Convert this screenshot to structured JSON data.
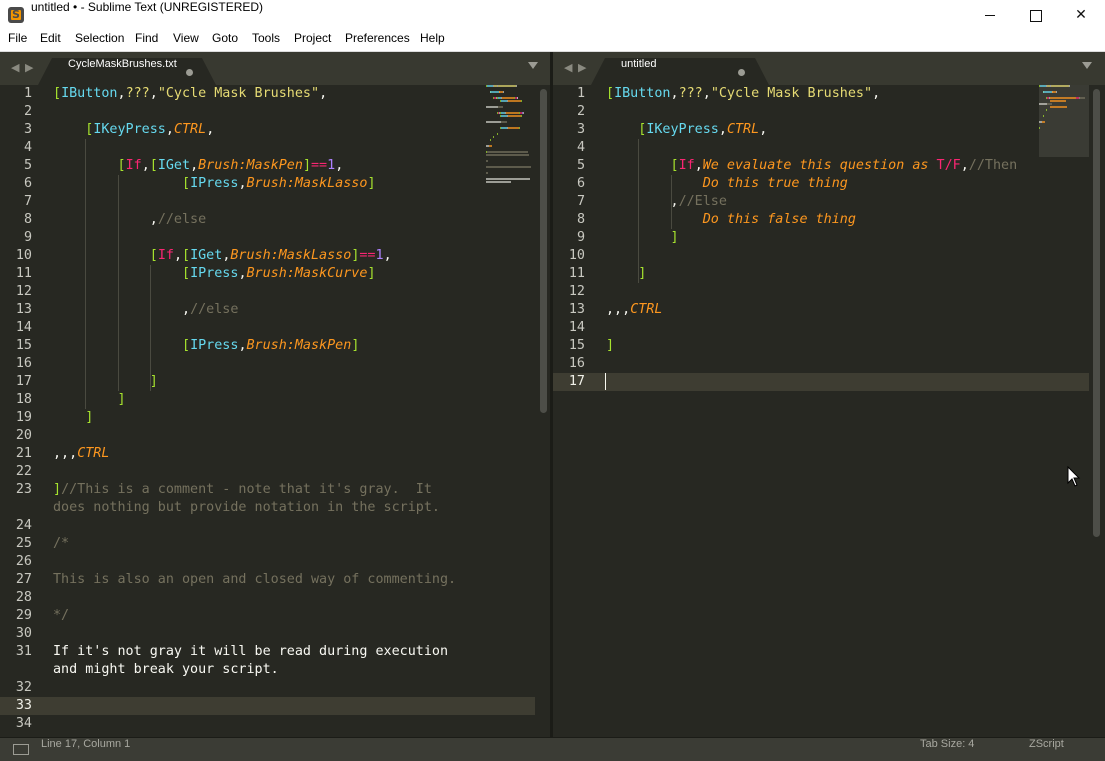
{
  "window": {
    "title": "untitled • - Sublime Text (UNREGISTERED)",
    "app_icon_glyph": "S",
    "minimize_glyph": "",
    "maximize_glyph": "",
    "close_glyph": "✕"
  },
  "menu": [
    "File",
    "Edit",
    "Selection",
    "Find",
    "View",
    "Goto",
    "Tools",
    "Project",
    "Preferences",
    "Help"
  ],
  "left_pane": {
    "tab_label": "CycleMaskBrushes.txt",
    "nav_back": "◀",
    "nav_forward": "▶",
    "lines": [
      {
        "n": "1",
        "tokens": [
          [
            "b",
            "["
          ],
          [
            "c",
            "IButton"
          ],
          [
            "w",
            ","
          ],
          [
            "y",
            "???"
          ],
          [
            "w",
            ","
          ],
          [
            "y",
            "\"Cycle Mask Brushes\""
          ],
          [
            "w",
            ","
          ]
        ]
      },
      {
        "n": "2",
        "tokens": []
      },
      {
        "n": "3",
        "tokens": [
          [
            "w",
            "    "
          ],
          [
            "b",
            "["
          ],
          [
            "c",
            "IKeyPress"
          ],
          [
            "w",
            ","
          ],
          [
            "o",
            "CTRL"
          ],
          [
            "w",
            ","
          ]
        ]
      },
      {
        "n": "4",
        "tokens": []
      },
      {
        "n": "5",
        "tokens": [
          [
            "w",
            "        "
          ],
          [
            "b",
            "["
          ],
          [
            "p",
            "If"
          ],
          [
            "w",
            ","
          ],
          [
            "b",
            "["
          ],
          [
            "c",
            "IGet"
          ],
          [
            "w",
            ","
          ],
          [
            "o",
            "Brush:MaskPen"
          ],
          [
            "b",
            "]"
          ],
          [
            "p",
            "=="
          ],
          [
            "n",
            "1"
          ],
          [
            "w",
            ","
          ]
        ]
      },
      {
        "n": "6",
        "tokens": [
          [
            "w",
            "                "
          ],
          [
            "b",
            "["
          ],
          [
            "c",
            "IPress"
          ],
          [
            "w",
            ","
          ],
          [
            "o",
            "Brush:MaskLasso"
          ],
          [
            "b",
            "]"
          ]
        ]
      },
      {
        "n": "7",
        "tokens": []
      },
      {
        "n": "8",
        "tokens": [
          [
            "w",
            "            ,"
          ],
          [
            "g",
            "//else"
          ]
        ]
      },
      {
        "n": "9",
        "tokens": []
      },
      {
        "n": "10",
        "tokens": [
          [
            "w",
            "            "
          ],
          [
            "b",
            "["
          ],
          [
            "p",
            "If"
          ],
          [
            "w",
            ","
          ],
          [
            "b",
            "["
          ],
          [
            "c",
            "IGet"
          ],
          [
            "w",
            ","
          ],
          [
            "o",
            "Brush:MaskLasso"
          ],
          [
            "b",
            "]"
          ],
          [
            "p",
            "=="
          ],
          [
            "n",
            "1"
          ],
          [
            "w",
            ","
          ]
        ]
      },
      {
        "n": "11",
        "tokens": [
          [
            "w",
            "                "
          ],
          [
            "b",
            "["
          ],
          [
            "c",
            "IPress"
          ],
          [
            "w",
            ","
          ],
          [
            "o",
            "Brush:MaskCurve"
          ],
          [
            "b",
            "]"
          ]
        ]
      },
      {
        "n": "12",
        "tokens": []
      },
      {
        "n": "13",
        "tokens": [
          [
            "w",
            "                ,"
          ],
          [
            "g",
            "//else"
          ]
        ]
      },
      {
        "n": "14",
        "tokens": []
      },
      {
        "n": "15",
        "tokens": [
          [
            "w",
            "                "
          ],
          [
            "b",
            "["
          ],
          [
            "c",
            "IPress"
          ],
          [
            "w",
            ","
          ],
          [
            "o",
            "Brush:MaskPen"
          ],
          [
            "b",
            "]"
          ]
        ]
      },
      {
        "n": "16",
        "tokens": []
      },
      {
        "n": "17",
        "tokens": [
          [
            "w",
            "            "
          ],
          [
            "b",
            "]"
          ]
        ]
      },
      {
        "n": "18",
        "tokens": [
          [
            "w",
            "        "
          ],
          [
            "b",
            "]"
          ]
        ]
      },
      {
        "n": "19",
        "tokens": [
          [
            "w",
            "    "
          ],
          [
            "b",
            "]"
          ]
        ]
      },
      {
        "n": "20",
        "tokens": []
      },
      {
        "n": "21",
        "tokens": [
          [
            "w",
            ",,,"
          ],
          [
            "o",
            "CTRL"
          ]
        ]
      },
      {
        "n": "22",
        "tokens": []
      },
      {
        "n": "23",
        "tokens": [
          [
            "b",
            "]"
          ],
          [
            "g",
            "//This is a comment - note that it's gray.  It"
          ]
        ]
      },
      {
        "n": "",
        "tokens": [
          [
            "g",
            "does nothing but provide notation in the script."
          ]
        ]
      },
      {
        "n": "24",
        "tokens": []
      },
      {
        "n": "25",
        "tokens": [
          [
            "g",
            "/*"
          ]
        ]
      },
      {
        "n": "26",
        "tokens": []
      },
      {
        "n": "27",
        "tokens": [
          [
            "g",
            "This is also an open and closed way of commenting."
          ]
        ]
      },
      {
        "n": "28",
        "tokens": []
      },
      {
        "n": "29",
        "tokens": [
          [
            "g",
            "*/"
          ]
        ]
      },
      {
        "n": "30",
        "tokens": []
      },
      {
        "n": "31",
        "tokens": [
          [
            "w",
            "If it's not gray it will be read during execution"
          ]
        ]
      },
      {
        "n": "",
        "tokens": [
          [
            "w",
            "and might break your script."
          ]
        ]
      },
      {
        "n": "32",
        "tokens": []
      },
      {
        "n": "33",
        "tokens": [],
        "current": true
      },
      {
        "n": "34",
        "tokens": []
      }
    ]
  },
  "right_pane": {
    "tab_label": "untitled",
    "nav_back": "◀",
    "nav_forward": "▶",
    "lines": [
      {
        "n": "1",
        "tokens": [
          [
            "b",
            "["
          ],
          [
            "c",
            "IButton"
          ],
          [
            "w",
            ","
          ],
          [
            "y",
            "???"
          ],
          [
            "w",
            ","
          ],
          [
            "y",
            "\"Cycle Mask Brushes\""
          ],
          [
            "w",
            ","
          ]
        ]
      },
      {
        "n": "2",
        "tokens": []
      },
      {
        "n": "3",
        "tokens": [
          [
            "w",
            "    "
          ],
          [
            "b",
            "["
          ],
          [
            "c",
            "IKeyPress"
          ],
          [
            "w",
            ","
          ],
          [
            "o",
            "CTRL"
          ],
          [
            "w",
            ","
          ]
        ]
      },
      {
        "n": "4",
        "tokens": []
      },
      {
        "n": "5",
        "tokens": [
          [
            "w",
            "        "
          ],
          [
            "b",
            "["
          ],
          [
            "p",
            "If"
          ],
          [
            "w",
            ","
          ],
          [
            "o",
            "We evaluate this question as "
          ],
          [
            "p",
            "T/F"
          ],
          [
            "w",
            ","
          ],
          [
            "g",
            "//Then"
          ]
        ]
      },
      {
        "n": "6",
        "tokens": [
          [
            "w",
            "            "
          ],
          [
            "o",
            "Do this true thing"
          ]
        ]
      },
      {
        "n": "7",
        "tokens": [
          [
            "w",
            "        ,"
          ],
          [
            "g",
            "//Else"
          ]
        ]
      },
      {
        "n": "8",
        "tokens": [
          [
            "w",
            "            "
          ],
          [
            "o",
            "Do this false thing"
          ]
        ]
      },
      {
        "n": "9",
        "tokens": [
          [
            "w",
            "        "
          ],
          [
            "b",
            "]"
          ]
        ]
      },
      {
        "n": "10",
        "tokens": []
      },
      {
        "n": "11",
        "tokens": [
          [
            "w",
            "    "
          ],
          [
            "b",
            "]"
          ]
        ]
      },
      {
        "n": "12",
        "tokens": []
      },
      {
        "n": "13",
        "tokens": [
          [
            "w",
            ",,,"
          ],
          [
            "o",
            "CTRL"
          ]
        ]
      },
      {
        "n": "14",
        "tokens": []
      },
      {
        "n": "15",
        "tokens": [
          [
            "b",
            "]"
          ]
        ]
      },
      {
        "n": "16",
        "tokens": []
      },
      {
        "n": "17",
        "tokens": [],
        "current": true
      }
    ]
  },
  "status": {
    "position": "Line 17, Column 1",
    "tab_size": "Tab Size: 4",
    "syntax": "ZScript"
  },
  "colors": {
    "editor_bg": "#272822",
    "bracket": "#a6e22e",
    "function": "#66d9ef",
    "constant": "#fd971f",
    "keyword": "#f92672",
    "number": "#ae81ff",
    "string": "#e6db74",
    "comment": "#75715e"
  }
}
